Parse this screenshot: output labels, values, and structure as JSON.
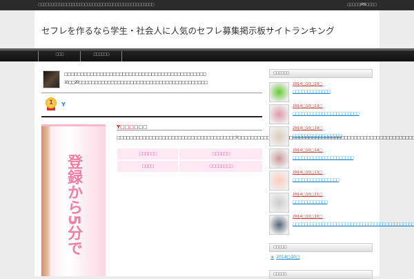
{
  "topbar": {
    "tagline": "□□□□□□□□□□□□□□□□□□□□□□□□□□□□□□□□□□□□□□□□□□□□□",
    "links": "□□□□□ | RSS□□□□"
  },
  "header": {
    "title": "セフレを作るなら学生・社会人に人気のセフレ募集掲示板サイトランキング"
  },
  "nav": [
    {
      "label": "□□□"
    },
    {
      "label": "□□□□□□"
    }
  ],
  "intro": {
    "line1": "□□□□□□□□□□□□□□□□□□□□□□□□□□□□□□□□□□□□□□□□□□□□",
    "line2": "10□□20□□□□□□□□□□□□□□□□□□□□□□□□□□□□□□□□□□□□□□□□"
  },
  "ranking": {
    "rank": "1",
    "name": "Y",
    "banner_text": "登録から5分で",
    "site_title_red": "Y□□□",
    "site_title_rest": "□□□",
    "description": "□□□□□□□□□□□□□□□□□□□□□□□□□□□□□□□□□□□□□Y□□□□□□□□□□□□□□□□□□□□□□□□□□□□□□□□□□□□□□□□□□□□□□□□□□□□□□□□□□□",
    "table": [
      "□□□□□□",
      "□□□□□□",
      "□□□□",
      "□□□□□□□□"
    ]
  },
  "sidebar": {
    "recent_title": "□□□□□□",
    "posts": [
      {
        "date": "2014□10□29□",
        "title": "□□□□□□□□□□□□□",
        "color": "#6c3"
      },
      {
        "date": "2014□10□23□",
        "title": "□□□□□□□□□□□□□□□□□□□□□□□",
        "color": "#d9a"
      },
      {
        "date": "2014□10□19□",
        "title": "□□□□□□□□□□□□□□□□□",
        "color": "#dcb"
      },
      {
        "date": "2014□10□14□",
        "title": "□□□□□□□□□□□□□□□□□□□□□",
        "color": "#c99"
      },
      {
        "date": "2014□10□13□",
        "title": "□□□□□□□□□□□□□□□□",
        "color": "#fcb"
      },
      {
        "date": "2014□10□11□",
        "title": "□□□□□□□□□□□□",
        "color": "#ccc"
      },
      {
        "date": "2014□10□10□",
        "title": "□□□□□□□□□□□□□□□□□□□□□□□□□□□□□□□□□□□□□□□□□□□□□□□",
        "color": "#567"
      }
    ],
    "archive_title": "□□□□□",
    "archive_item": "2014□10□",
    "third_title": "□□□□□"
  }
}
